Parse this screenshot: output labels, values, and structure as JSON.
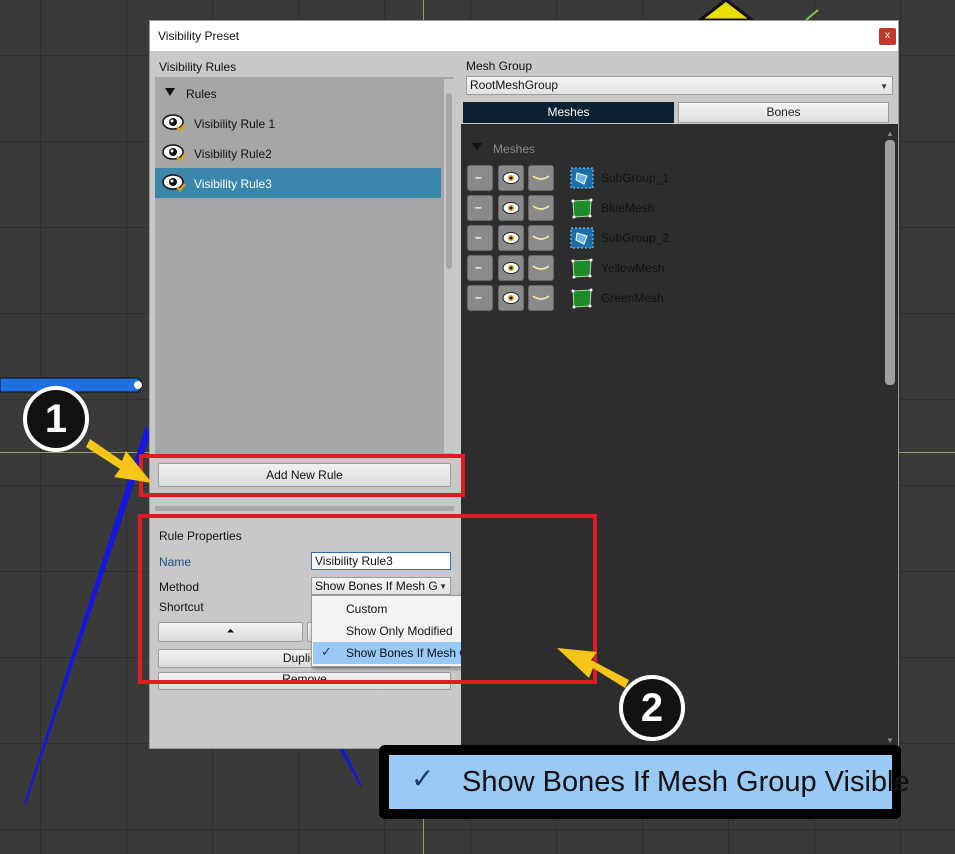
{
  "window": {
    "title": "Visibility Preset",
    "close_label": "x"
  },
  "rules_section": {
    "header": "Visibility Rules",
    "tree_root": "Rules",
    "items": [
      {
        "label": "Visibility Rule 1",
        "selected": false
      },
      {
        "label": "Visibility Rule2",
        "selected": false
      },
      {
        "label": "Visibility Rule3",
        "selected": true
      }
    ],
    "add_button": "Add New Rule"
  },
  "rule_properties": {
    "header": "Rule Properties",
    "name_label": "Name",
    "name_value": "Visibility Rule3",
    "method_label": "Method",
    "method_value": "Show Bones If Mesh G",
    "shortcut_label": "Shortcut",
    "up_arrow": "⏶",
    "duplicate_label": "Duplic",
    "remove_label": "Remove"
  },
  "method_dropdown": {
    "options": [
      {
        "label": "Custom",
        "selected": false
      },
      {
        "label": "Show Only Modified",
        "selected": false
      },
      {
        "label": "Show Bones If Mesh Group Visible",
        "selected": true
      }
    ],
    "check_glyph": "✓"
  },
  "mesh_group": {
    "header": "Mesh Group",
    "selected": "RootMeshGroup",
    "tabs": [
      {
        "label": "Meshes",
        "active": true
      },
      {
        "label": "Bones",
        "active": false
      }
    ],
    "list_header": "Meshes",
    "meshes": [
      {
        "name": "SubGroup_1",
        "type": "subgroup"
      },
      {
        "name": "BlueMesh",
        "type": "mesh"
      },
      {
        "name": "SubGroup_2",
        "type": "subgroup"
      },
      {
        "name": "YellowMesh",
        "type": "mesh"
      },
      {
        "name": "GreenMesh",
        "type": "mesh"
      }
    ],
    "minus_glyph": "–"
  },
  "annotations": {
    "step1": "1",
    "step2": "2",
    "zoom_check": "✓",
    "zoom_text": "Show Bones If Mesh Group Visible"
  },
  "colors": {
    "highlight_red": "#e11b22",
    "arrow_yellow": "#f5c518",
    "selected_rule": "#3b87ac",
    "selected_option": "#99c9f5",
    "active_tab": "#0c2233",
    "mesh_green": "#1e8a2a",
    "subgroup_blue": "#1a6fa8"
  }
}
